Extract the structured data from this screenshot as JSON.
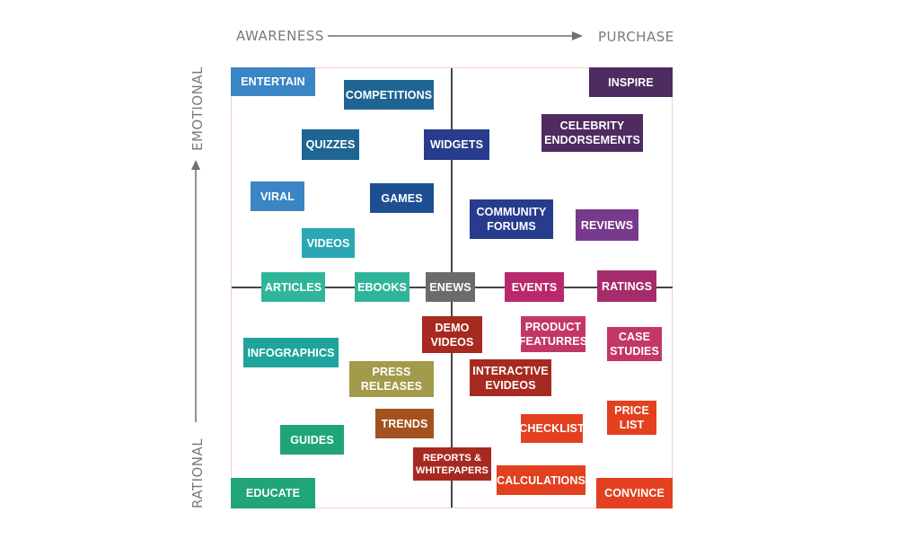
{
  "axes": {
    "x_left": "AWARENESS",
    "x_right": "PURCHASE",
    "y_top": "EMOTIONAL",
    "y_bottom": "RATIONAL"
  },
  "tiles": {
    "entertain": {
      "label": "ENTERTAIN",
      "color": "#3a85c4"
    },
    "competitions": {
      "label": "COMPETITIONS",
      "color": "#1f6593"
    },
    "inspire": {
      "label": "INSPIRE",
      "color": "#4e2b61"
    },
    "quizzes": {
      "label": "QUIZZES",
      "color": "#1f6593"
    },
    "widgets": {
      "label": "WIDGETS",
      "color": "#283c8e"
    },
    "celebrity": {
      "label1": "CELEBRITY",
      "label2": "ENDORSEMENTS",
      "color": "#4e2b61"
    },
    "viral": {
      "label": "VIRAL",
      "color": "#3a85c4"
    },
    "games": {
      "label": "GAMES",
      "color": "#1e4f92"
    },
    "community": {
      "label1": "COMMUNITY",
      "label2": "FORUMS",
      "color": "#283c8e"
    },
    "reviews": {
      "label": "REVIEWS",
      "color": "#783a8c"
    },
    "videos": {
      "label": "VIDEOS",
      "color": "#2ba7b4"
    },
    "articles": {
      "label": "ARTICLES",
      "color": "#31b59a"
    },
    "ebooks": {
      "label": "EBOOKS",
      "color": "#31b59a"
    },
    "enews": {
      "label": "ENEWS",
      "color": "#6b6b6b"
    },
    "events": {
      "label": "EVENTS",
      "color": "#b9286c"
    },
    "ratings": {
      "label": "RATINGS",
      "color": "#a52c6a"
    },
    "demo_videos": {
      "label1": "DEMO",
      "label2": "VIDEOS",
      "color": "#a72a20"
    },
    "product_features": {
      "label1": "PRODUCT",
      "label2": "FEATURRES",
      "color": "#c23765"
    },
    "case_studies": {
      "label1": "CASE",
      "label2": "STUDIES",
      "color": "#c23765"
    },
    "infographics": {
      "label": "INFOGRAPHICS",
      "color": "#1fa39d"
    },
    "press_releases": {
      "label1": "PRESS",
      "label2": "RELEASES",
      "color": "#a39a4b"
    },
    "interactive_evideos": {
      "label1": "INTERACTIVE",
      "label2": "EVIDEOS",
      "color": "#a72a20"
    },
    "trends": {
      "label": "TRENDS",
      "color": "#a3511e"
    },
    "checklist": {
      "label": "CHECKLIST",
      "color": "#e3401f"
    },
    "price_list": {
      "label1": "PRICE",
      "label2": "LIST",
      "color": "#e3401f"
    },
    "guides": {
      "label": "GUIDES",
      "color": "#20a47a"
    },
    "reports": {
      "label1": "REPORTS &",
      "label2": "WHITEPAPERS",
      "color": "#a72a20"
    },
    "calculations": {
      "label": "CALCULATIONS",
      "color": "#e3401f"
    },
    "educate": {
      "label": "EDUCATE",
      "color": "#20a47a"
    },
    "convince": {
      "label": "CONVINCE",
      "color": "#e3401f"
    }
  }
}
